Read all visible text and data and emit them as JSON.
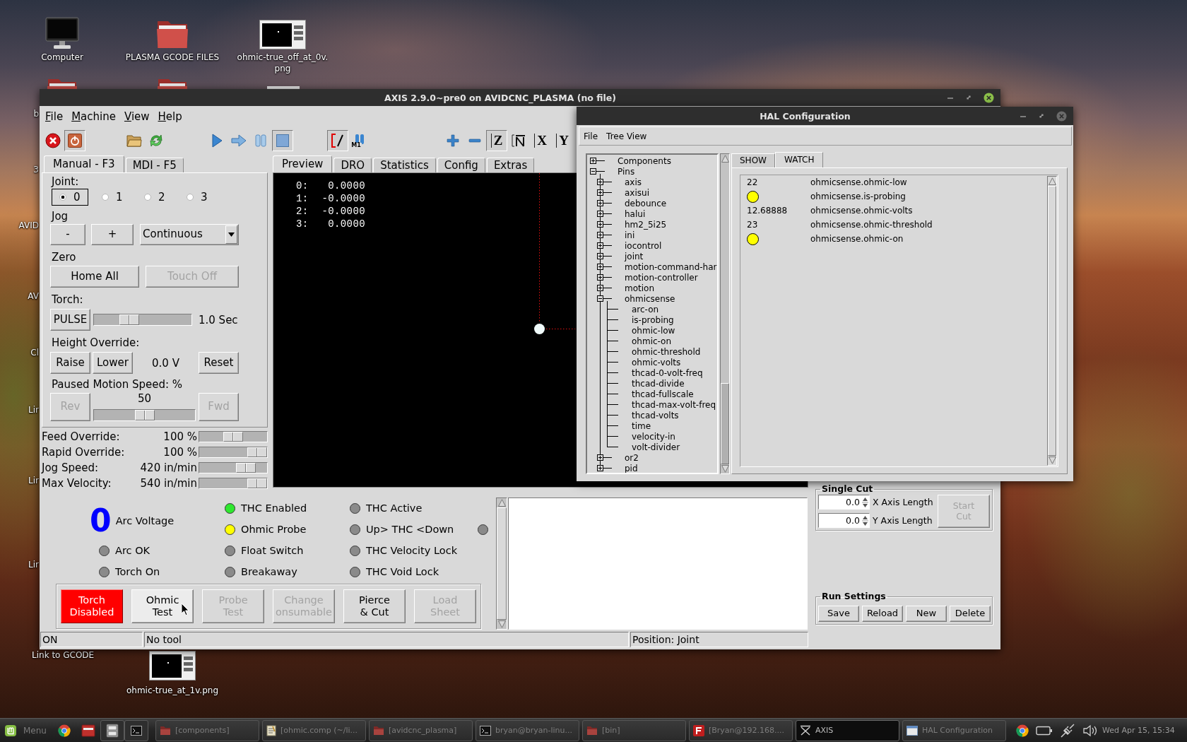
{
  "desktop": {
    "icons": [
      {
        "kind": "computer",
        "label": "Computer"
      },
      {
        "kind": "folder",
        "label": "PLASMA GCODE FILES"
      },
      {
        "kind": "image",
        "label": "ohmic-true_off_at_0v.\npng"
      }
    ],
    "partial_icons": [
      {
        "kind": "folder"
      },
      {
        "kind": "folder"
      },
      {
        "kind": "image"
      }
    ],
    "edge_labels": [
      "b",
      "3",
      "AVID",
      "AV",
      "Cl",
      "Lir",
      "Lir",
      "Lir"
    ],
    "bottom_label": "Link to GCODE",
    "bottom_icon": {
      "kind": "image",
      "label": "ohmic-true_at_1v.png"
    }
  },
  "axis_window": {
    "title": "AXIS 2.9.0~pre0 on AVIDCNC_PLASMA (no file)",
    "menu": [
      "File",
      "Machine",
      "View",
      "Help"
    ],
    "toolbar": [
      [
        {
          "kind": "estop",
          "pressed": false
        },
        {
          "kind": "power",
          "pressed": true
        }
      ],
      [
        {
          "kind": "open",
          "pressed": false
        },
        {
          "kind": "reload",
          "pressed": false
        }
      ],
      [
        {
          "kind": "run",
          "pressed": false
        },
        {
          "kind": "step",
          "pressed": false
        },
        {
          "kind": "pause",
          "pressed": false
        },
        {
          "kind": "stop",
          "pressed": true
        }
      ],
      [
        {
          "kind": "skip",
          "pressed": true
        },
        {
          "kind": "optional_stop",
          "label": "M1",
          "pressed": false
        }
      ],
      [
        {
          "kind": "zoom_in",
          "pressed": false
        },
        {
          "kind": "zoom_out",
          "pressed": false
        },
        {
          "kind": "view",
          "label": "Z",
          "pressed": true
        },
        {
          "kind": "view_p",
          "pressed": false
        },
        {
          "kind": "view",
          "label": "X",
          "pressed": false
        },
        {
          "kind": "view",
          "label": "Y",
          "pressed": false
        }
      ]
    ],
    "manual_tabs": [
      {
        "label": "Manual - F3",
        "selected": true
      },
      {
        "label": "MDI - F5",
        "selected": false
      }
    ],
    "manual": {
      "joint_label": "Joint:",
      "joints": [
        {
          "label": "0",
          "selected": true
        },
        {
          "label": "1",
          "selected": false
        },
        {
          "label": "2",
          "selected": false
        },
        {
          "label": "3",
          "selected": false
        }
      ],
      "jog_label": "Jog",
      "jog_buttons": [
        {
          "label": "-",
          "disabled": false
        },
        {
          "label": "+",
          "disabled": false
        }
      ],
      "jog_mode": "Continuous",
      "zero_label": "Zero",
      "zero_buttons": [
        {
          "label": "Home All",
          "disabled": false
        },
        {
          "label": "Touch Off",
          "disabled": true
        }
      ],
      "torch_label": "Torch:",
      "pulse_button": {
        "label": "PULSE",
        "disabled": false
      },
      "pulse_slider": {
        "level": 0.33
      },
      "pulse_reading": "1.0 Sec",
      "height_label": "Height Override:",
      "height_buttons": [
        {
          "label": "Raise",
          "disabled": false
        },
        {
          "label": "Lower",
          "disabled": false
        }
      ],
      "height_reading": "0.0 V",
      "reset_button": {
        "label": "Reset",
        "disabled": false
      },
      "paused_label": "Paused Motion Speed: %",
      "rev_button": {
        "label": "Rev",
        "disabled": true
      },
      "paused_value": "50",
      "paused_slider": {
        "level": 0.5
      },
      "fwd_button": {
        "label": "Fwd",
        "disabled": true
      }
    },
    "overrides": [
      {
        "label": "Feed Override:",
        "reading": "100 %",
        "level": 0.5
      },
      {
        "label": "Rapid Override:",
        "reading": "100 %",
        "level": 1
      },
      {
        "label": "Jog Speed:",
        "reading": "420 in/min",
        "level": 0.76
      },
      {
        "label": "Max Velocity:",
        "reading": "540 in/min",
        "level": 1
      }
    ],
    "preview_tabs": [
      {
        "label": "Preview",
        "selected": true
      },
      {
        "label": "DRO",
        "selected": false
      },
      {
        "label": "Statistics",
        "selected": false
      },
      {
        "label": "Config",
        "selected": false
      },
      {
        "label": "Extras",
        "selected": false
      }
    ],
    "dro": [
      {
        "label": "0:",
        "value": "0.0000"
      },
      {
        "label": "1:",
        "value": "-0.0000"
      },
      {
        "label": "2:",
        "value": "-0.0000"
      },
      {
        "label": "3:",
        "value": "0.0000"
      }
    ],
    "arc_voltage": {
      "value": "0",
      "label": "Arc Voltage"
    },
    "led_columns": [
      [
        {
          "label": "Arc OK",
          "color": "#8a8a8a"
        },
        {
          "label": "Torch On",
          "color": "#8a8a8a"
        }
      ],
      [
        {
          "label": "THC Enabled",
          "color": "#2ee82e"
        },
        {
          "label": "Ohmic Probe",
          "color": "#ffff00"
        },
        {
          "label": "Float Switch",
          "color": "#8a8a8a"
        },
        {
          "label": "Breakaway",
          "color": "#8a8a8a"
        }
      ],
      [
        {
          "label": "THC Active",
          "color": "#8a8a8a"
        },
        {
          "label": "Up> THC <Down",
          "color": "#8a8a8a"
        },
        {
          "label": "THC Velocity Lock",
          "color": "#8a8a8a"
        },
        {
          "label": "THC Void Lock",
          "color": "#8a8a8a"
        }
      ]
    ],
    "trailing_led": {
      "color": "#8a8a8a"
    },
    "action_buttons": [
      {
        "label": "Torch\nDisabled",
        "alarm": true,
        "disabled": false,
        "hovered": false
      },
      {
        "label": "Ohmic\nTest",
        "alarm": false,
        "disabled": false,
        "hovered": true
      },
      {
        "label": "Probe\nTest",
        "alarm": false,
        "disabled": true,
        "hovered": false
      },
      {
        "label": "Change\nonsumable",
        "alarm": false,
        "disabled": true,
        "hovered": false
      },
      {
        "label": "Pierce\n& Cut",
        "alarm": false,
        "disabled": false,
        "hovered": false
      },
      {
        "label": "Load\nSheet",
        "alarm": false,
        "disabled": true,
        "hovered": false
      }
    ],
    "single_cut": {
      "title": "Single Cut",
      "fields": [
        {
          "value": "0.0",
          "label": "X Axis Length"
        },
        {
          "value": "0.0",
          "label": "Y Axis Length"
        }
      ],
      "start_button": {
        "label": "Start\nCut",
        "disabled": true
      }
    },
    "run_settings": {
      "title": "Run Settings",
      "buttons": [
        "Save",
        "Reload",
        "New",
        "Delete"
      ]
    },
    "status_bar": [
      "ON",
      "No tool",
      "Position: Joint"
    ]
  },
  "hal_window": {
    "title": "HAL Configuration",
    "menu": [
      "File",
      "Tree View"
    ],
    "tree": [
      {
        "label": "Components",
        "expanded": false
      },
      {
        "label": "Pins",
        "expanded": true,
        "children": [
          {
            "label": "axis",
            "expanded": false
          },
          {
            "label": "axisui",
            "expanded": false
          },
          {
            "label": "debounce",
            "expanded": false
          },
          {
            "label": "halui",
            "expanded": false
          },
          {
            "label": "hm2_5i25",
            "expanded": false
          },
          {
            "label": "ini",
            "expanded": false
          },
          {
            "label": "iocontrol",
            "expanded": false
          },
          {
            "label": "joint",
            "expanded": false
          },
          {
            "label": "motion-command-har",
            "expanded": false
          },
          {
            "label": "motion-controller",
            "expanded": false
          },
          {
            "label": "motion",
            "expanded": false
          },
          {
            "label": "ohmicsense",
            "expanded": true,
            "children": [
              {
                "label": "arc-on"
              },
              {
                "label": "is-probing"
              },
              {
                "label": "ohmic-low"
              },
              {
                "label": "ohmic-on"
              },
              {
                "label": "ohmic-threshold"
              },
              {
                "label": "ohmic-volts"
              },
              {
                "label": "thcad-0-volt-freq"
              },
              {
                "label": "thcad-divide"
              },
              {
                "label": "thcad-fullscale"
              },
              {
                "label": "thcad-max-volt-freq"
              },
              {
                "label": "thcad-volts"
              },
              {
                "label": "time"
              },
              {
                "label": "velocity-in"
              },
              {
                "label": "volt-divider"
              }
            ]
          },
          {
            "label": "or2",
            "expanded": false
          },
          {
            "label": "pid",
            "expanded": false
          }
        ]
      }
    ],
    "tabs": [
      {
        "label": "SHOW",
        "selected": false
      },
      {
        "label": "WATCH",
        "selected": true
      }
    ],
    "watch": [
      {
        "kind": "value",
        "value": "22",
        "pin": "ohmicsense.ohmic-low"
      },
      {
        "kind": "bit",
        "on": true,
        "pin": "ohmicsense.is-probing"
      },
      {
        "kind": "value",
        "value": "12.68888",
        "pin": "ohmicsense.ohmic-volts"
      },
      {
        "kind": "value",
        "value": "23",
        "pin": "ohmicsense.ohmic-threshold"
      },
      {
        "kind": "bit",
        "on": true,
        "pin": "ohmicsense.ohmic-on"
      }
    ]
  },
  "taskbar": {
    "menu_label": "Menu",
    "launchers": [
      {
        "kind": "browser"
      },
      {
        "kind": "app"
      },
      {
        "kind": "files"
      },
      {
        "kind": "terminal"
      }
    ],
    "windows": [
      {
        "kind": "folder",
        "label": "[components]",
        "selected": false
      },
      {
        "kind": "text",
        "label": "[ohmic.comp (~/li...",
        "selected": false
      },
      {
        "kind": "folder",
        "label": "[avidcnc_plasma]",
        "selected": false
      },
      {
        "kind": "terminal",
        "label": "bryan@bryan-linu...",
        "selected": false
      },
      {
        "kind": "folder",
        "label": "[bin]",
        "selected": false
      },
      {
        "kind": "ftp",
        "label": "[Bryan@192.168....",
        "selected": false
      },
      {
        "kind": "axis",
        "label": "AXIS",
        "selected": true
      },
      {
        "kind": "hal",
        "label": "HAL Configuration",
        "selected": false
      }
    ],
    "tray": [
      {
        "kind": "browser"
      },
      {
        "kind": "battery"
      },
      {
        "kind": "network"
      },
      {
        "kind": "volume"
      }
    ],
    "clock": "Wed Apr 15, 15:34"
  }
}
